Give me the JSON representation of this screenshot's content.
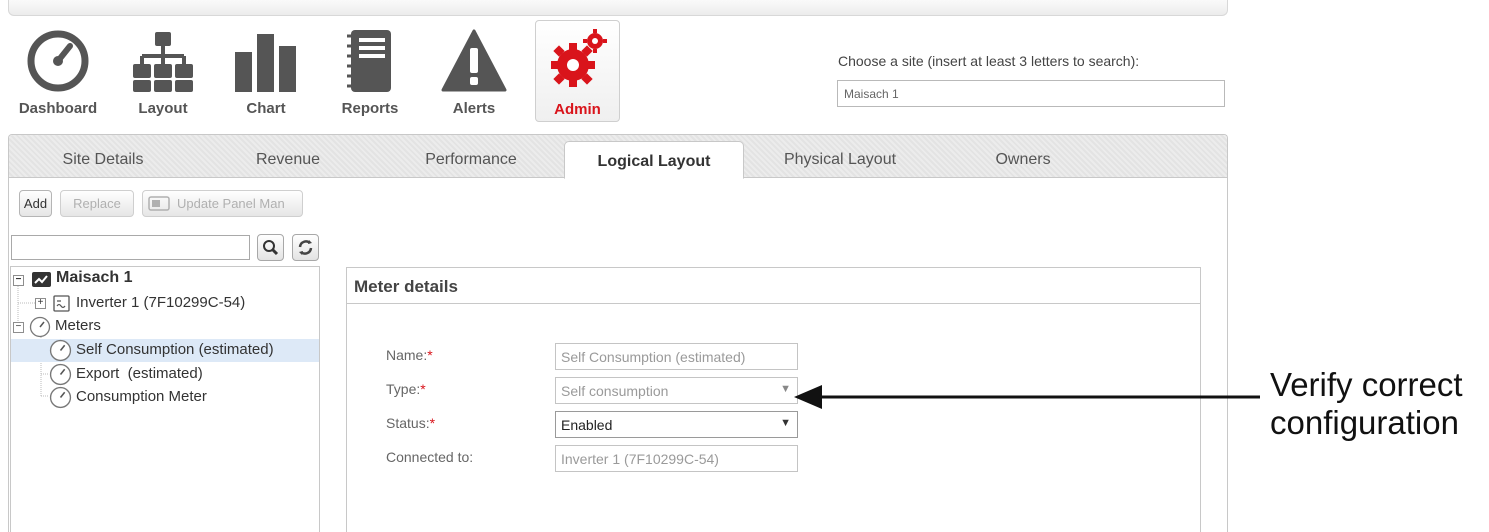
{
  "nav": {
    "dashboard": "Dashboard",
    "layout": "Layout",
    "chart": "Chart",
    "reports": "Reports",
    "alerts": "Alerts",
    "admin": "Admin"
  },
  "site_search": {
    "label": "Choose a site (insert at least 3 letters to search):",
    "value": "Maisach 1"
  },
  "tabs": [
    "Site Details",
    "Revenue",
    "Performance",
    "Logical Layout",
    "Physical Layout",
    "Owners"
  ],
  "active_tab": "Logical Layout",
  "toolbar": {
    "add": "Add",
    "replace": "Replace",
    "update_panel": "Update Panel Man"
  },
  "tree": {
    "root": "Maisach 1",
    "inverter": "Inverter 1 (7F10299C-54)",
    "meters": "Meters",
    "meter_items": [
      "Self Consumption (estimated)",
      "Export  (estimated)",
      "Consumption Meter"
    ]
  },
  "details": {
    "title": "Meter details",
    "name_label": "Name:",
    "name_value": "Self Consumption (estimated)",
    "type_label": "Type:",
    "type_value": "Self consumption",
    "status_label": "Status:",
    "status_value": "Enabled",
    "connected_label": "Connected to:",
    "connected_value": "Inverter 1 (7F10299C-54)",
    "required_mark": "*"
  },
  "annotation": {
    "line1": "Verify correct",
    "line2": "configuration"
  },
  "colors": {
    "accent_red": "#d9141b",
    "icon_gray": "#555555",
    "selected_row": "#dde9f7"
  }
}
